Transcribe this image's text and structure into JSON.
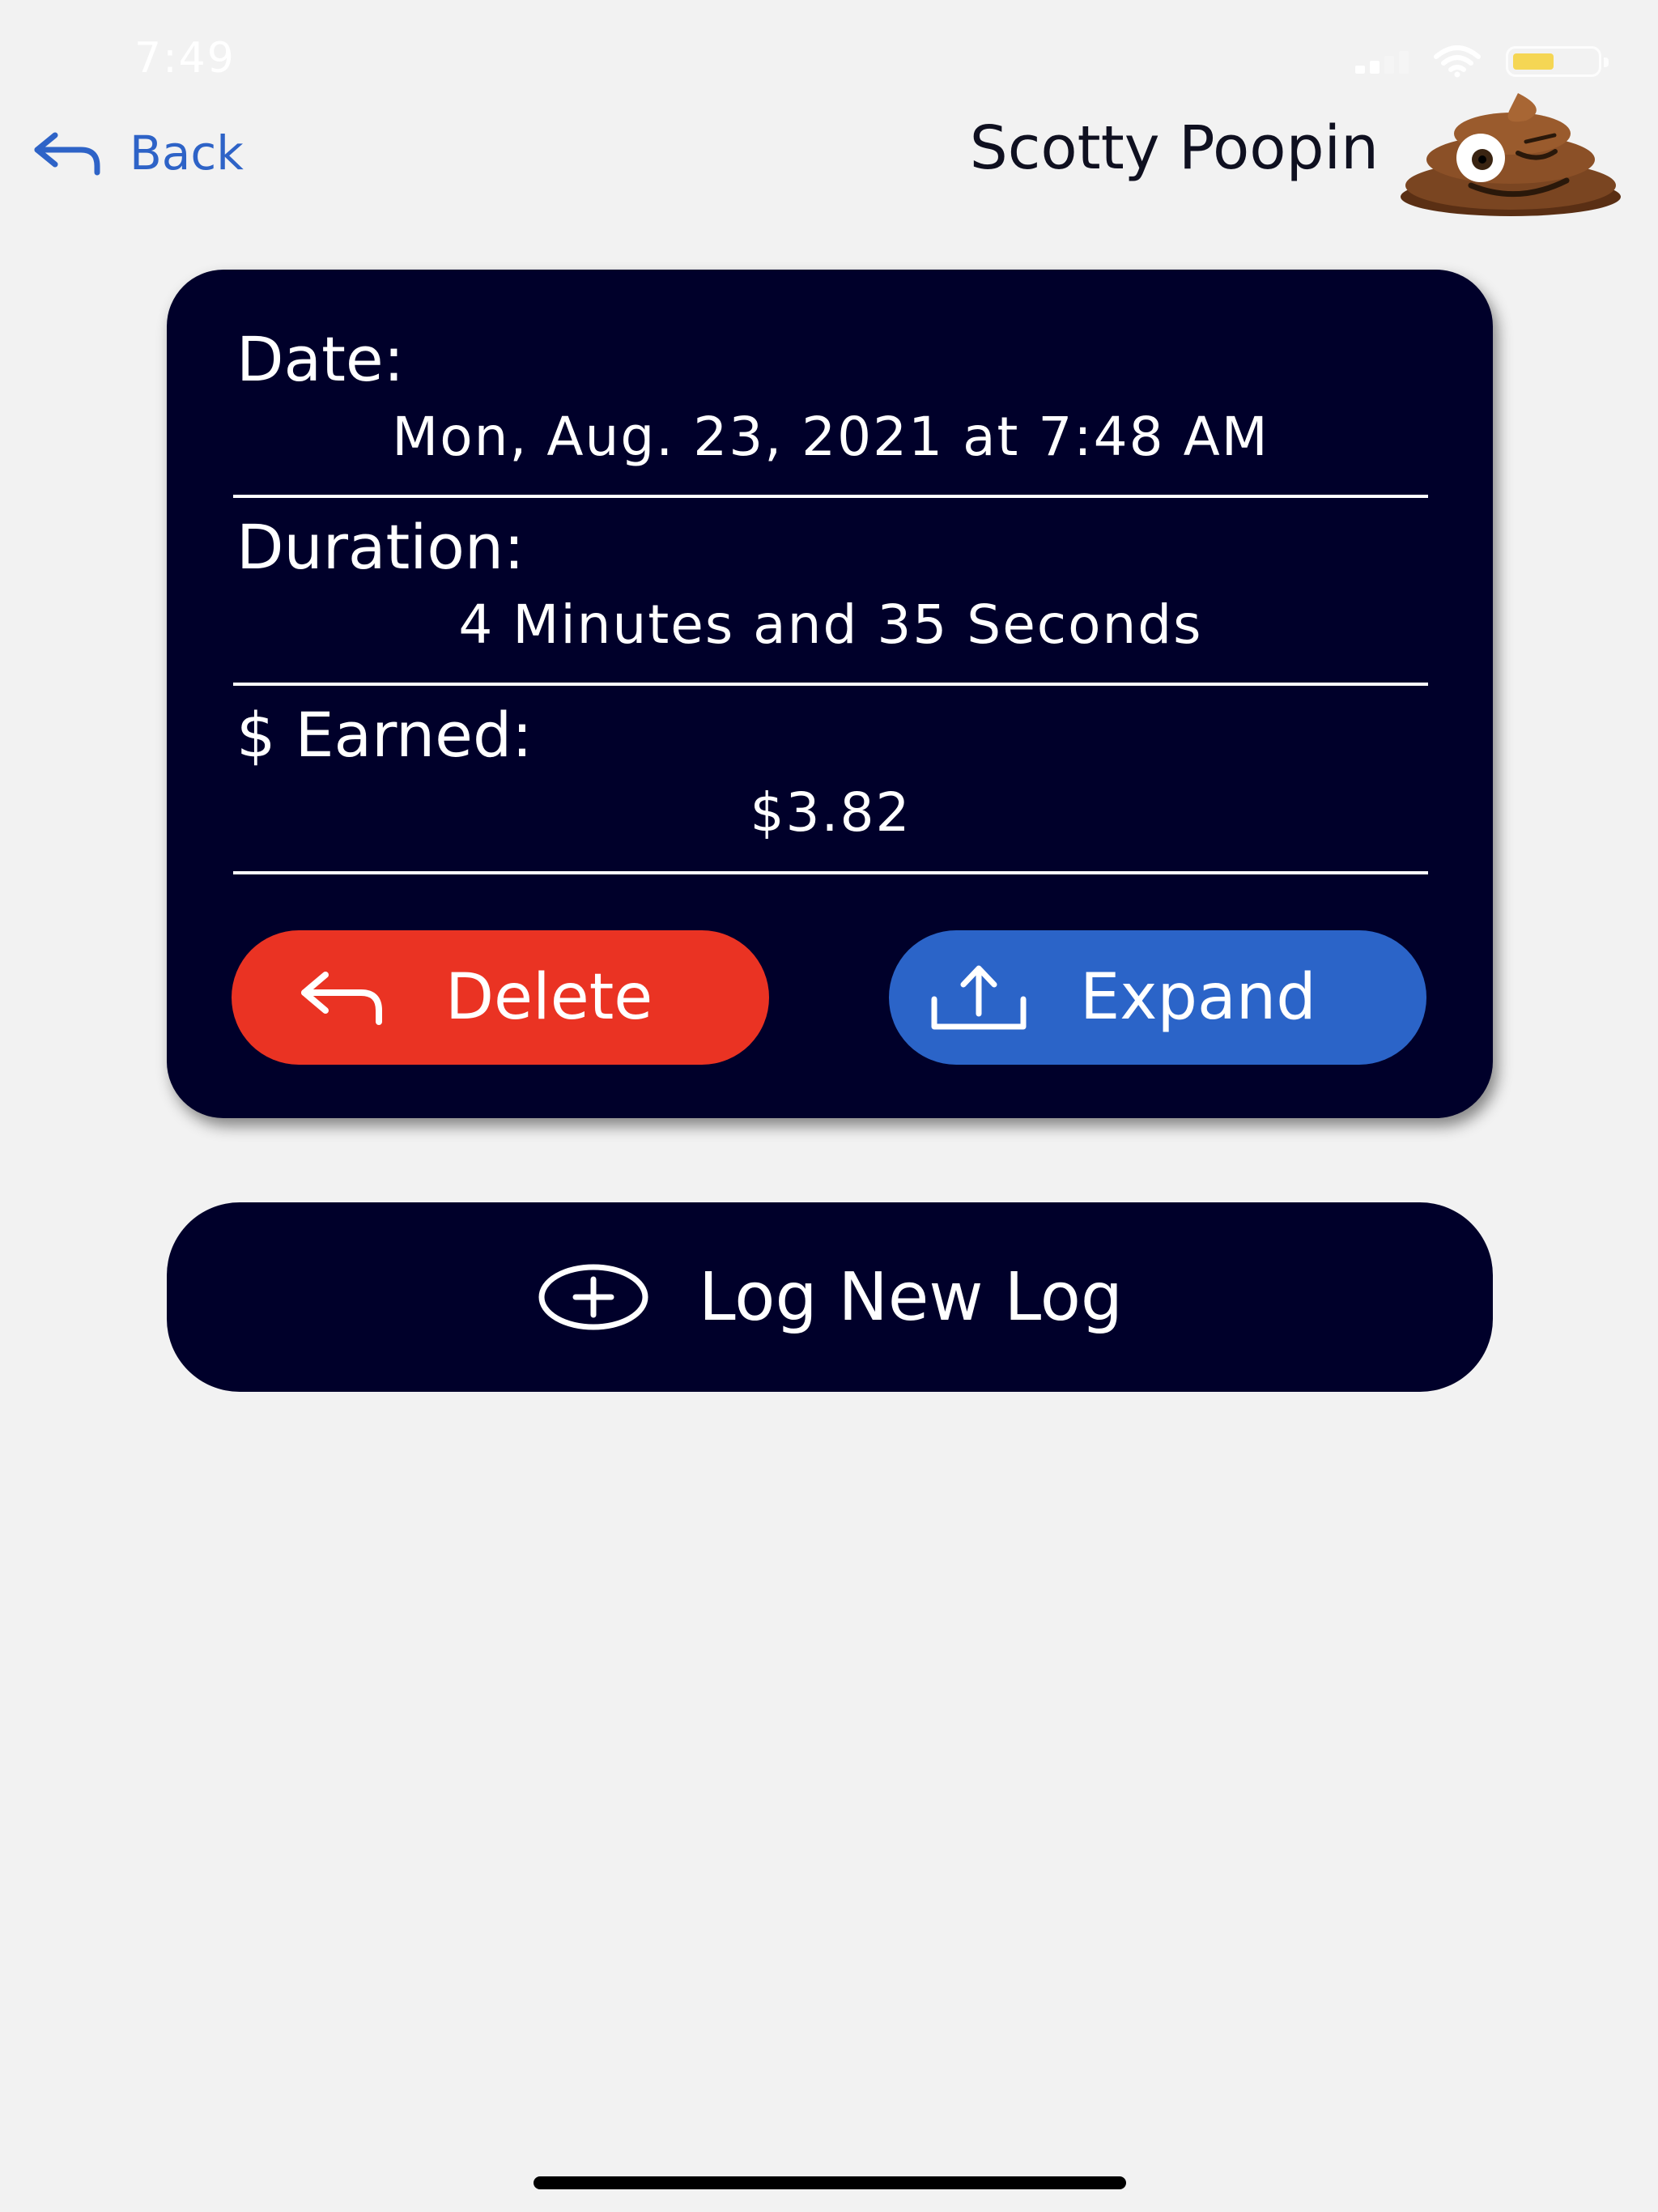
{
  "status_bar": {
    "time": "7:49"
  },
  "nav": {
    "back_label": "Back",
    "title": "Scotty Poopin"
  },
  "log_card": {
    "date_label": "Date:",
    "date_value": "Mon, Aug. 23, 2021 at 7:48 AM",
    "duration_label": "Duration:",
    "duration_value": "4 Minutes and 35 Seconds",
    "earned_label": "$ Earned:",
    "earned_value": "$3.82",
    "delete_label": "Delete",
    "expand_label": "Expand"
  },
  "log_new_label": "Log New Log",
  "colors": {
    "card": "#00002a",
    "delete": "#ea3323",
    "expand": "#2b64c8",
    "link": "#2e63c7",
    "background": "#f2f2f2"
  },
  "icons": {
    "back": "back-arrow-icon",
    "avatar": "poop-emoji-icon",
    "delete": "undo-arrow-icon",
    "expand": "share-upload-icon",
    "log_new": "plus-circle-icon"
  }
}
